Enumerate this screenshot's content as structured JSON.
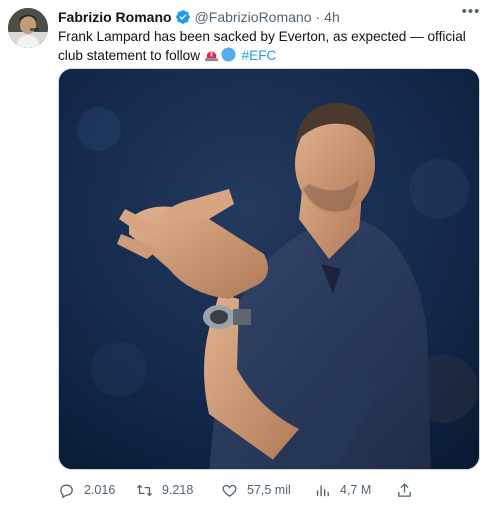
{
  "tweet": {
    "author_name": "Fabrizio Romano",
    "handle": "@FabrizioRomano",
    "separator": "·",
    "time": "4h",
    "text_main": "Frank Lampard has been sacked by Everton, as expected — official club statement to follow",
    "hashtag": "#EFC",
    "emojis": [
      "siren-emoji",
      "blue-circle-emoji"
    ],
    "more_icon": "more-options-icon",
    "verified_icon": "verified-badge-icon"
  },
  "stats": {
    "replies": "2.016",
    "retweets": "9.218",
    "likes": "57,5 mil",
    "views": "4,7 M"
  },
  "colors": {
    "accent": "#1d9bf0",
    "secondary_text": "#536471",
    "primary_text": "#0f1419",
    "siren": "#e0245e"
  }
}
